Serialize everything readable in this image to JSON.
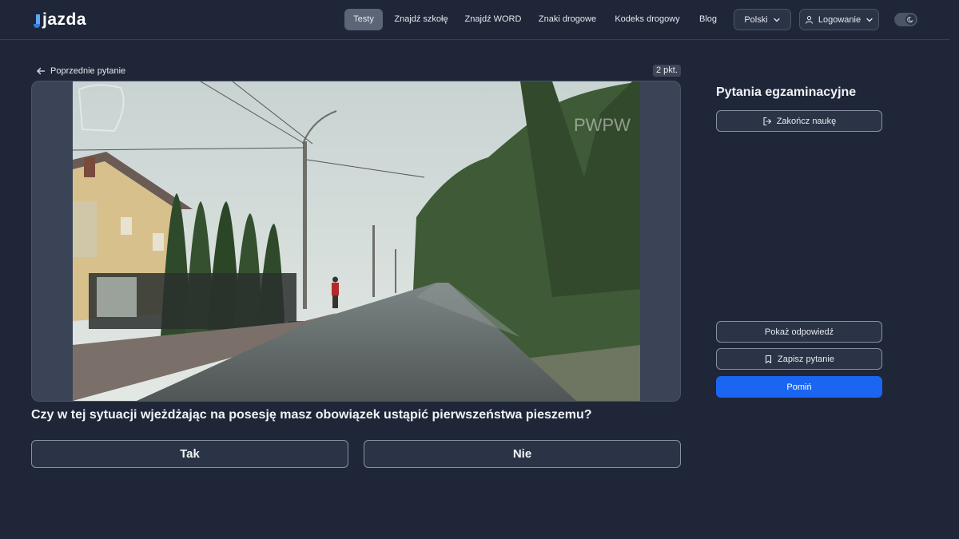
{
  "header": {
    "logo_text": "jazda",
    "nav": [
      {
        "label": "Testy",
        "active": true
      },
      {
        "label": "Znajdź szkołę",
        "active": false
      },
      {
        "label": "Znajdź WORD",
        "active": false
      },
      {
        "label": "Znaki drogowe",
        "active": false
      },
      {
        "label": "Kodeks drogowy",
        "active": false
      },
      {
        "label": "Blog",
        "active": false
      }
    ],
    "language_label": "Polski",
    "login_label": "Logowanie",
    "theme_toggle_icon": "moon-icon"
  },
  "main": {
    "prev_label": "Poprzednie pytanie",
    "points_label": "2 pkt.",
    "media_watermarks": [
      "PWPW"
    ],
    "question": "Czy w tej sytuacji wjeżdżając na posesję masz obowiązek ustąpić pierwszeństwa pieszemu?",
    "answers": [
      {
        "label": "Tak"
      },
      {
        "label": "Nie"
      }
    ]
  },
  "sidebar": {
    "title": "Pytania egzaminacyjne",
    "end_label": "Zakończ naukę",
    "show_answer_label": "Pokaż odpowiedź",
    "save_label": "Zapisz pytanie",
    "skip_label": "Pomiń"
  },
  "colors": {
    "background": "#1e2638",
    "primary": "#1a66f2",
    "accent_logo": "#5da9f5"
  }
}
